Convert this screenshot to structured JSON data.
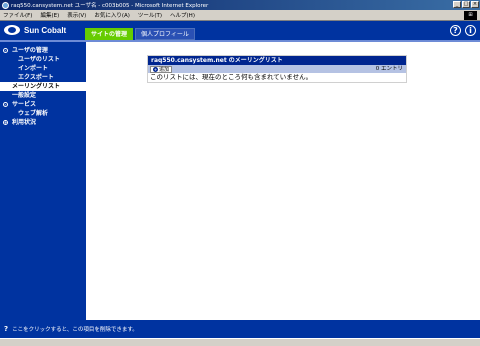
{
  "window": {
    "title": "raq550.cansystem.net ユーザ名 - c003b005 - Microsoft Internet Explorer",
    "controls": [
      "_",
      "□",
      "×"
    ]
  },
  "menu": {
    "items": [
      "ファイル(F)",
      "編集(E)",
      "表示(V)",
      "お気に入り(A)",
      "ツール(T)",
      "ヘルプ(H)"
    ]
  },
  "header": {
    "brand": "Sun Cobalt",
    "tabs": [
      {
        "label": "サイトの管理",
        "active": true
      },
      {
        "label": "個人プロフィール",
        "active": false
      }
    ],
    "help_label": "?",
    "info_label": "i"
  },
  "sidebar": {
    "items": [
      {
        "label": "ユーザの管理"
      },
      {
        "label": "ユーザのリスト"
      },
      {
        "label": "インポート"
      },
      {
        "label": "エクスポート"
      },
      {
        "label": "メーリングリスト"
      },
      {
        "label": "一般設定"
      },
      {
        "label": "サービス"
      },
      {
        "label": "ウェブ解析"
      },
      {
        "label": "利用状況"
      }
    ]
  },
  "panel": {
    "title": "raq550.cansystem.net のメーリングリスト",
    "add_label": "追加",
    "count": "0 エントリ",
    "empty_message": "このリストには、現在のところ何も含まれていません。"
  },
  "status": {
    "icon": "?",
    "message": "ここをクリックすると、この項目を削除できます。"
  }
}
